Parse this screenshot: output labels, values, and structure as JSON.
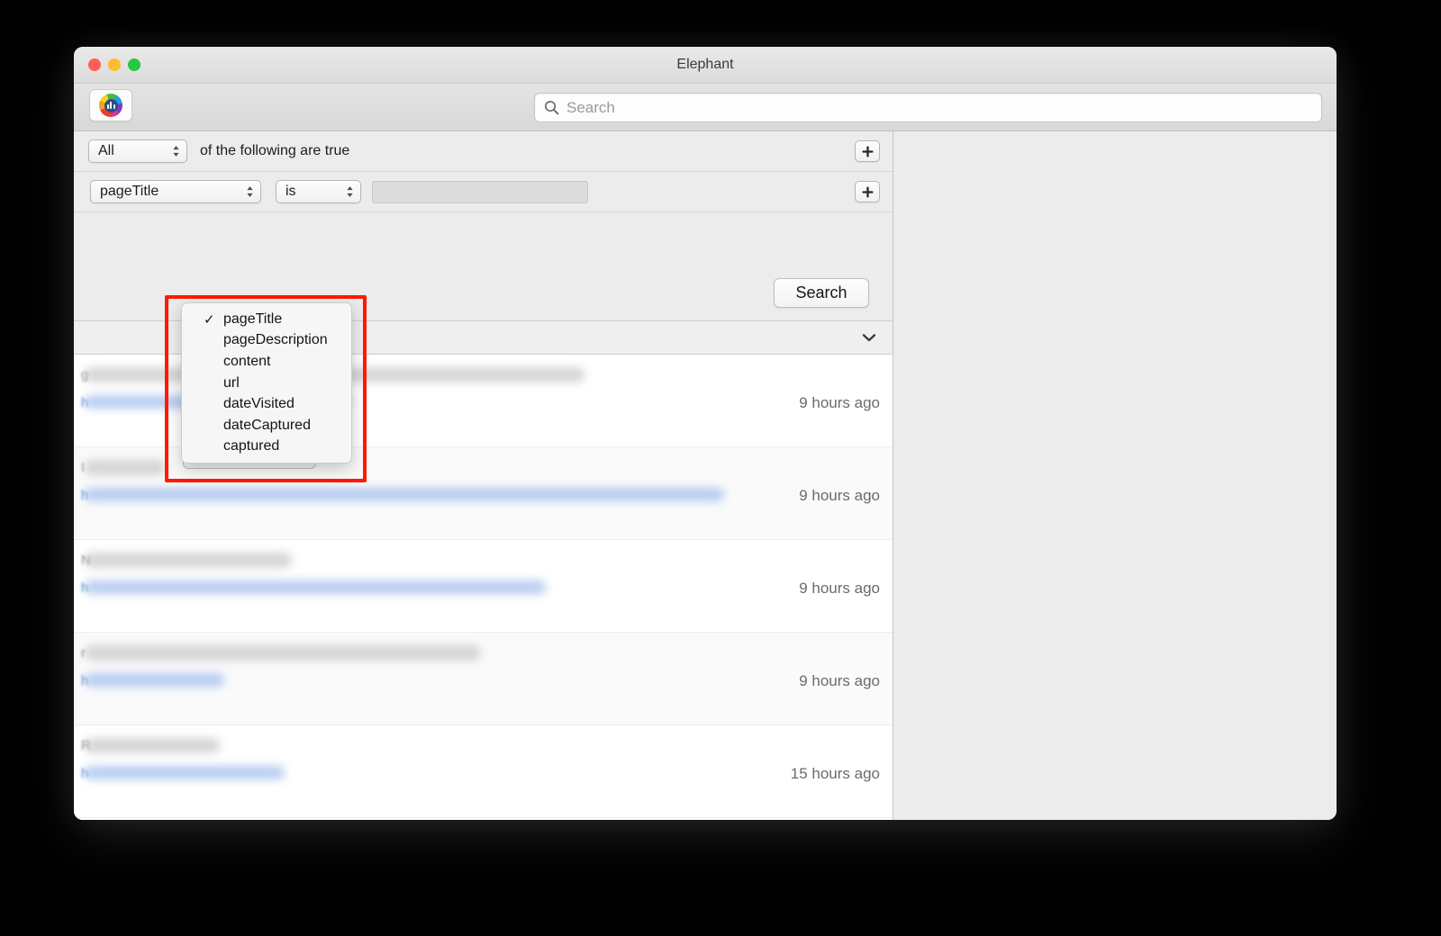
{
  "window": {
    "title": "Elephant",
    "traffic_lights": [
      "close",
      "minimize",
      "zoom"
    ]
  },
  "toolbar": {
    "app_icon": "elephant-app-icon",
    "search": {
      "placeholder": "Search",
      "value": "",
      "icon": "search-icon"
    }
  },
  "predicate_editor": {
    "compound_row": {
      "match_select_value": "All",
      "suffix_label": "of the following are true",
      "add_button_label": "+"
    },
    "criterion_row": {
      "field_select_value": "pageTitle",
      "operator_select_value": "is",
      "value_input": "",
      "value_input_placeholder": "",
      "add_button_label": "+"
    },
    "search_button_label": "Search"
  },
  "field_menu": {
    "open": true,
    "selected": "pageTitle",
    "items": [
      {
        "label": "pageTitle",
        "checked": true
      },
      {
        "label": "pageDescription",
        "checked": false
      },
      {
        "label": "content",
        "checked": false
      },
      {
        "label": "url",
        "checked": false
      },
      {
        "label": "dateVisited",
        "checked": false
      },
      {
        "label": "dateCaptured",
        "checked": false
      },
      {
        "label": "captured",
        "checked": false
      }
    ],
    "highlight_color": "#ff1a00"
  },
  "sort_bar": {
    "disclosure_icon": "chevron-down-icon"
  },
  "results": {
    "rows": [
      {
        "title_redacted": true,
        "title_first_char": "g",
        "url_first_char": "h",
        "time": "9 hours ago",
        "title_w": 555,
        "title_w2": 160,
        "url_w": 295
      },
      {
        "title_redacted": true,
        "title_first_char": "I",
        "url_first_char": "h",
        "time": "9 hours ago",
        "title_w": 90,
        "title_w2": 0,
        "url_w": 710
      },
      {
        "title_redacted": true,
        "title_first_char": "N",
        "url_first_char": "h",
        "time": "9 hours ago",
        "title_w": 230,
        "title_w2": 0,
        "url_w": 512
      },
      {
        "title_redacted": true,
        "title_first_char": "r",
        "url_first_char": "h",
        "time": "9 hours ago",
        "title_w": 440,
        "title_w2": 0,
        "url_w": 155
      },
      {
        "title_redacted": true,
        "title_first_char": "R",
        "url_first_char": "h",
        "time": "15 hours ago",
        "title_w": 150,
        "title_w2": 0,
        "url_w": 222
      }
    ]
  },
  "right_pane": {
    "content": ""
  }
}
